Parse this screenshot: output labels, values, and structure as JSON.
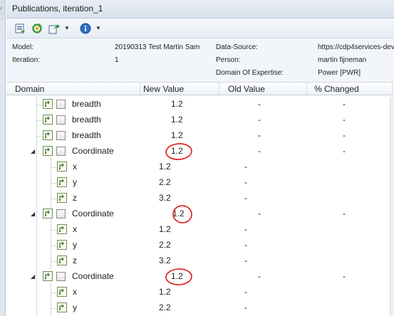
{
  "window": {
    "title": "Publications, iteration_1"
  },
  "toolbar": {
    "buttons": [
      {
        "name": "publish-icon"
      },
      {
        "name": "refresh-icon"
      },
      {
        "name": "export-icon"
      },
      {
        "name": "info-icon"
      }
    ]
  },
  "info": {
    "model_label": "Model:",
    "model_value": "20190313 Test Martin Sam",
    "iteration_label": "Iteration:",
    "iteration_value": "1",
    "datasource_label": "Data-Source:",
    "datasource_value": "https://cdp4services-dev",
    "person_label": "Person:",
    "person_value": "martin fijneman",
    "doe_label": "Domain Of Expertise:",
    "doe_value": "Power [PWR]"
  },
  "columns": {
    "domain": "Domain",
    "new_value": "New Value",
    "old_value": "Old Value",
    "changed": "% Changed"
  },
  "rows": [
    {
      "label": "breadth",
      "new": "1.2",
      "old": "-",
      "changed": "-"
    },
    {
      "label": "breadth",
      "new": "1.2",
      "old": "-",
      "changed": "-"
    },
    {
      "label": "breadth",
      "new": "1.2",
      "old": "-",
      "changed": "-"
    },
    {
      "label": "Coordinate",
      "new": "1.2",
      "old": "-",
      "changed": "-"
    },
    {
      "label": "x",
      "new": "1.2",
      "old": "-"
    },
    {
      "label": "y",
      "new": "2.2",
      "old": "-"
    },
    {
      "label": "z",
      "new": "3.2",
      "old": "-"
    },
    {
      "label": "Coordinate",
      "new": "1.2",
      "old": "-",
      "changed": "-"
    },
    {
      "label": "x",
      "new": "1.2",
      "old": "-"
    },
    {
      "label": "y",
      "new": "2.2",
      "old": "-"
    },
    {
      "label": "z",
      "new": "3.2",
      "old": "-"
    },
    {
      "label": "Coordinate",
      "new": "1.2",
      "old": "-",
      "changed": "-"
    },
    {
      "label": "x",
      "new": "1.2",
      "old": "-"
    },
    {
      "label": "y",
      "new": "2.2",
      "old": "-"
    }
  ],
  "colors": {
    "annotation": "#e01616",
    "pin": "#6f8f57"
  }
}
